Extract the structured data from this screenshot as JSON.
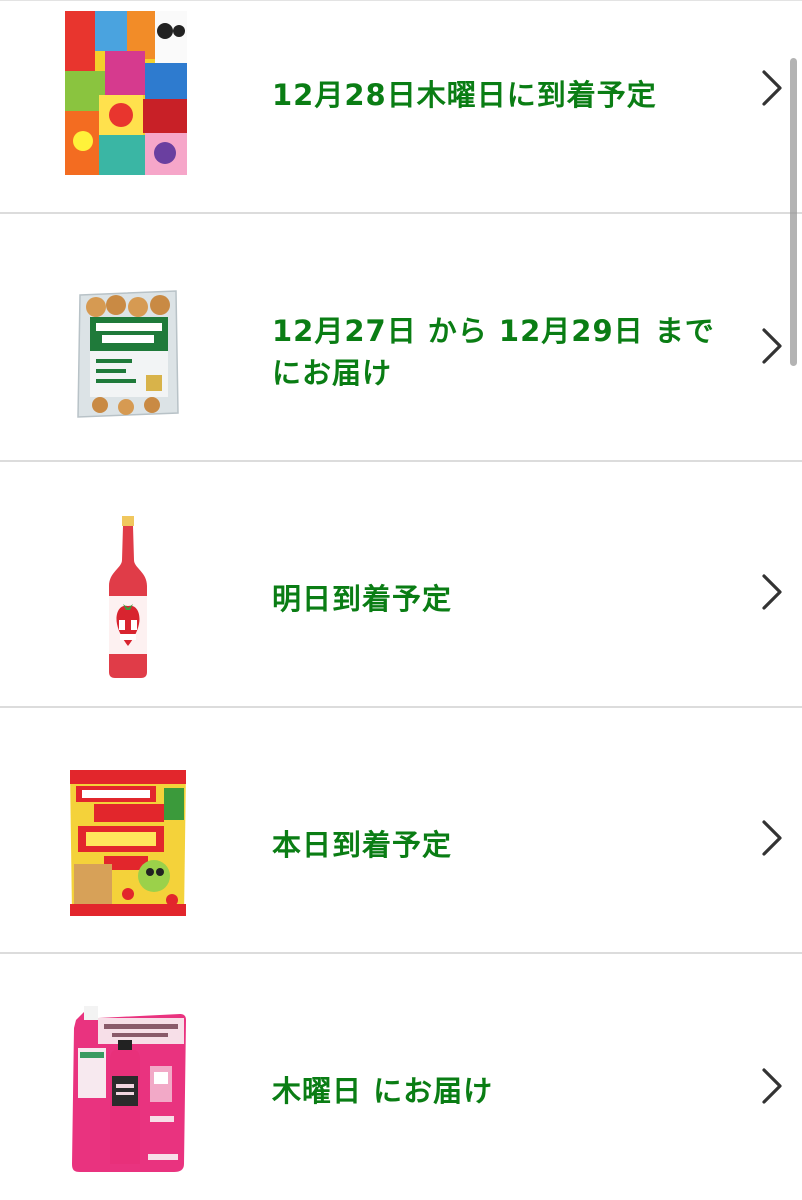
{
  "orders": [
    {
      "status": "12月28日木曜日に到着予定",
      "product_icon": "candy-assortment-icon"
    },
    {
      "status": "12月27日 から 12月29日 までにお届け",
      "product_icon": "fried-chicken-pack-icon"
    },
    {
      "status": "明日到着予定",
      "product_icon": "strawberry-liqueur-bottle-icon"
    },
    {
      "status": "本日到着予定",
      "product_icon": "snack-bag-icon"
    },
    {
      "status": "木曜日 にお届け",
      "product_icon": "softener-refill-pouch-icon"
    }
  ],
  "colors": {
    "status_text": "#0a7d14",
    "divider": "#dcdcdc",
    "chevron": "#333333"
  }
}
